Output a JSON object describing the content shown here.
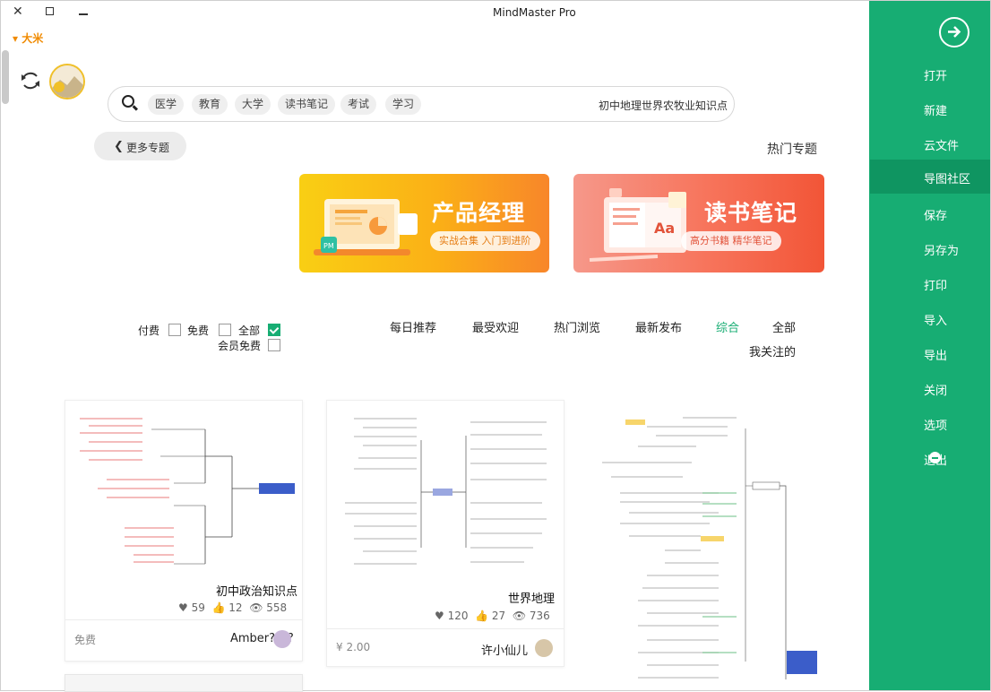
{
  "window": {
    "title": "MindMaster Pro",
    "user_menu": "▾ 大米"
  },
  "sidebar": {
    "items": [
      {
        "label": "打开"
      },
      {
        "label": "新建"
      },
      {
        "label": "云文件"
      },
      {
        "label": "导图社区"
      },
      {
        "label": "保存"
      },
      {
        "label": "另存为"
      },
      {
        "label": "打印"
      },
      {
        "label": "导入"
      },
      {
        "label": "导出"
      },
      {
        "label": "关闭"
      },
      {
        "label": "选项"
      },
      {
        "label": "退出"
      }
    ],
    "active": "导图社区",
    "colors": {
      "bg": "#17ad73",
      "active_bg": "#0f9561"
    }
  },
  "search": {
    "value": "初中地理世界农牧业知识点",
    "tags": [
      "学习",
      "考试",
      "读书笔记",
      "大学",
      "教育",
      "医学"
    ]
  },
  "topics": {
    "title": "热门专题",
    "more_label": "更多专题",
    "banners": [
      {
        "title": "读书笔记",
        "subtitle": "高分书籍 精华笔记"
      },
      {
        "title": "产品经理",
        "subtitle": "实战合集 入门到进阶"
      }
    ]
  },
  "filters": {
    "tabs": [
      "全部",
      "综合",
      "最新发布",
      "热门浏览",
      "最受欢迎",
      "每日推荐",
      "我关注的"
    ],
    "active": "综合",
    "price_options": [
      {
        "label": "全部",
        "checked": true
      },
      {
        "label": "免费",
        "checked": false
      },
      {
        "label": "付费",
        "checked": false
      },
      {
        "label": "会员免费",
        "checked": false
      }
    ]
  },
  "cards": [
    {
      "title": "初中政治知识点",
      "views": "558",
      "likes": "12",
      "favorites": "59",
      "author": "Amber????",
      "price": "免费"
    },
    {
      "title": "世界地理",
      "views": "736",
      "likes": "27",
      "favorites": "120",
      "author": "许小仙儿",
      "price": "¥ 2.00"
    }
  ]
}
